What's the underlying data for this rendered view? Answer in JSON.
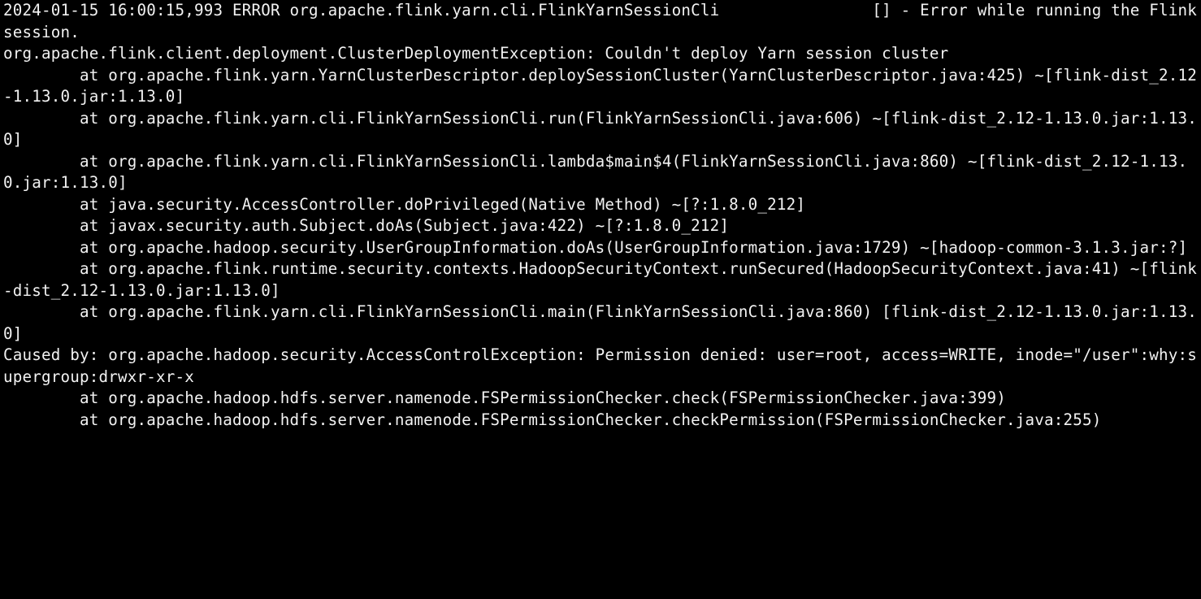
{
  "terminal": {
    "lines": [
      "2024-01-15 16:00:15,993 ERROR org.apache.flink.yarn.cli.FlinkYarnSessionCli                [] - Error while running the Flink session.",
      "org.apache.flink.client.deployment.ClusterDeploymentException: Couldn't deploy Yarn session cluster",
      "        at org.apache.flink.yarn.YarnClusterDescriptor.deploySessionCluster(YarnClusterDescriptor.java:425) ~[flink-dist_2.12-1.13.0.jar:1.13.0]",
      "        at org.apache.flink.yarn.cli.FlinkYarnSessionCli.run(FlinkYarnSessionCli.java:606) ~[flink-dist_2.12-1.13.0.jar:1.13.0]",
      "        at org.apache.flink.yarn.cli.FlinkYarnSessionCli.lambda$main$4(FlinkYarnSessionCli.java:860) ~[flink-dist_2.12-1.13.0.jar:1.13.0]",
      "        at java.security.AccessController.doPrivileged(Native Method) ~[?:1.8.0_212]",
      "        at javax.security.auth.Subject.doAs(Subject.java:422) ~[?:1.8.0_212]",
      "        at org.apache.hadoop.security.UserGroupInformation.doAs(UserGroupInformation.java:1729) ~[hadoop-common-3.1.3.jar:?]",
      "        at org.apache.flink.runtime.security.contexts.HadoopSecurityContext.runSecured(HadoopSecurityContext.java:41) ~[flink-dist_2.12-1.13.0.jar:1.13.0]",
      "        at org.apache.flink.yarn.cli.FlinkYarnSessionCli.main(FlinkYarnSessionCli.java:860) [flink-dist_2.12-1.13.0.jar:1.13.0]",
      "Caused by: org.apache.hadoop.security.AccessControlException: Permission denied: user=root, access=WRITE, inode=\"/user\":why:supergroup:drwxr-xr-x",
      "        at org.apache.hadoop.hdfs.server.namenode.FSPermissionChecker.check(FSPermissionChecker.java:399)",
      "        at org.apache.hadoop.hdfs.server.namenode.FSPermissionChecker.checkPermission(FSPermissionChecker.java:255)"
    ]
  }
}
